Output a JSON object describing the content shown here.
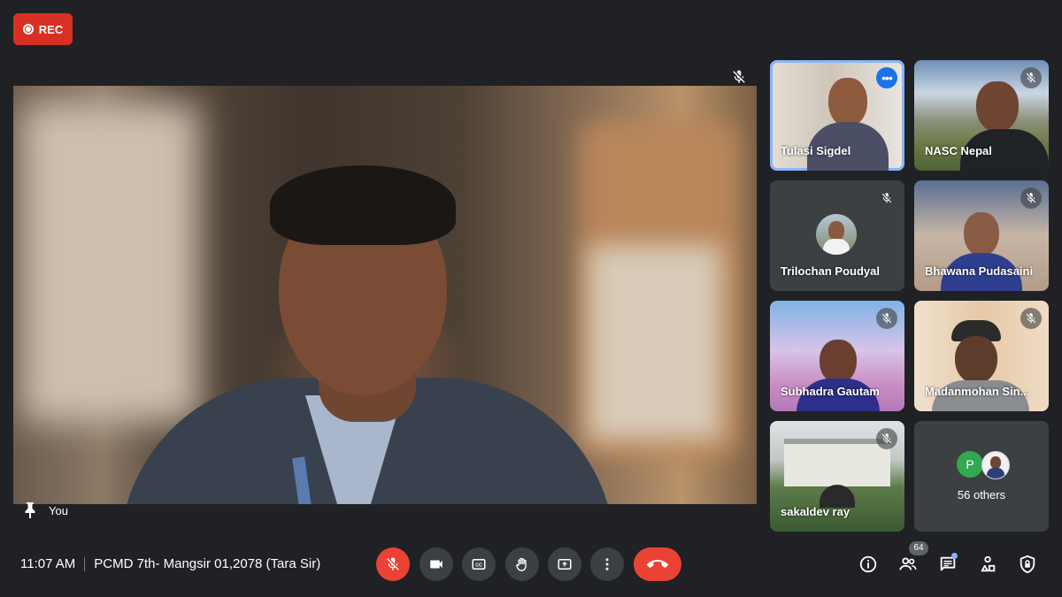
{
  "recording": {
    "label": "REC",
    "color": "#d93025"
  },
  "main": {
    "speaker_label": "You"
  },
  "participants": [
    {
      "name": "Tulasi Sigdel",
      "active": true
    },
    {
      "name": "NASC Nepal"
    },
    {
      "name": "Trilochan Poudyal"
    },
    {
      "name": "Bhawana Pudasaini"
    },
    {
      "name": "Subhadra Gautam"
    },
    {
      "name": "Madanmohan Sin..."
    },
    {
      "name": "sakaldev ray"
    }
  ],
  "others": {
    "avatar_letter": "P",
    "label": "56 others"
  },
  "bottom_bar": {
    "time": "11:07 AM",
    "meeting_title": "PCMD 7th- Mangsir 01,2078 (Tara Sir)",
    "people_count": "64"
  },
  "colors": {
    "end_call": "#ea4335",
    "accent": "#8ab4f8",
    "background": "#202124"
  }
}
